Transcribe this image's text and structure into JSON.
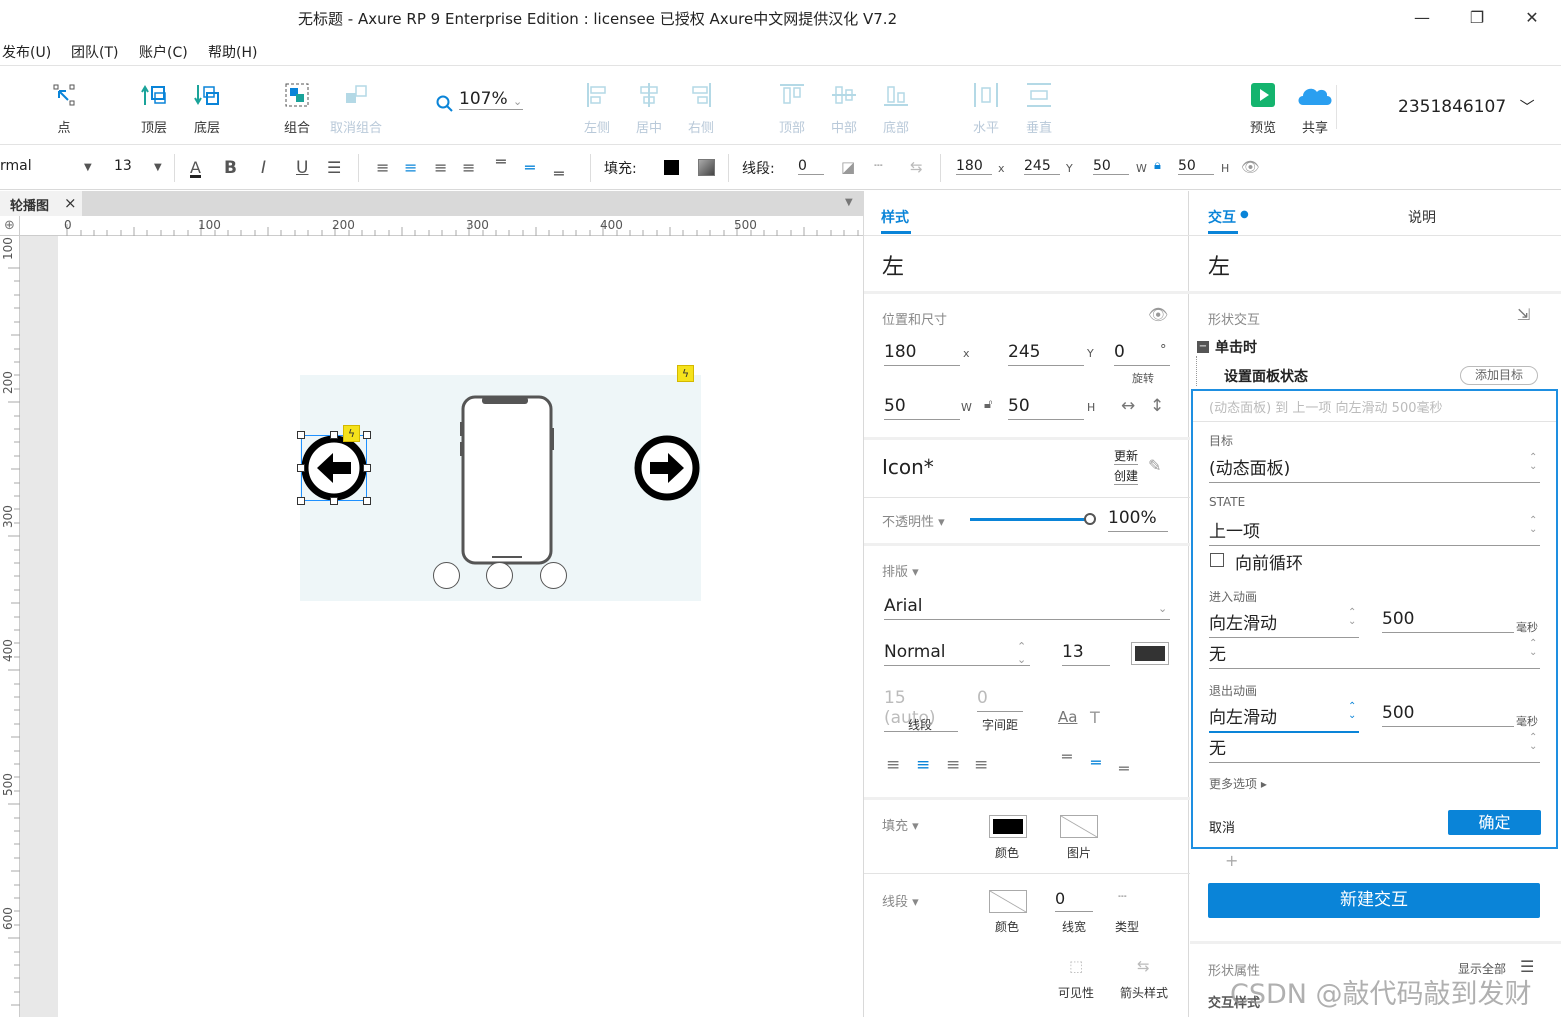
{
  "window": {
    "title": "无标题 - Axure RP 9 Enterprise Edition : licensee 已授权     Axure中文网提供汉化 V7.2",
    "minimize": "—",
    "restore": "❐",
    "close": "✕"
  },
  "menu": {
    "items": [
      "发布(U)",
      "团队(T)",
      "账户(C)",
      "帮助(H)"
    ]
  },
  "toolbar": {
    "point": "点",
    "top_layer": "顶层",
    "bottom_layer": "底层",
    "group": "组合",
    "ungroup": "取消组合",
    "zoom": "107%",
    "align_left": "左侧",
    "align_center": "居中",
    "align_right": "右侧",
    "align_top": "顶部",
    "align_middle": "中部",
    "align_bottom": "底部",
    "distribute_h": "水平",
    "distribute_v": "垂直",
    "preview": "预览",
    "share": "共享",
    "account": "2351846107"
  },
  "format": {
    "style": "rmal",
    "font_size": "13",
    "bold": "B",
    "italic": "I",
    "underline": "U",
    "fill_label": "填充:",
    "stroke_label": "线段:",
    "stroke_value": "0",
    "x": "180",
    "x_unit": "x",
    "y": "245",
    "y_unit": "Y",
    "w": "50",
    "w_unit": "W",
    "h": "50",
    "h_unit": "H"
  },
  "tab": {
    "name": "轮播图",
    "close": "×"
  },
  "ruler": {
    "h_ticks": [
      "0",
      "100",
      "200",
      "300",
      "400",
      "500"
    ],
    "v_ticks": [
      "100",
      "200",
      "300",
      "400",
      "500",
      "600"
    ]
  },
  "style_panel": {
    "tab": "样式",
    "name": "左",
    "pos_size_label": "位置和尺寸",
    "x": "180",
    "x_unit": "x",
    "y": "245",
    "y_unit": "Y",
    "rotate": "0",
    "rotate_unit": "°",
    "rotate_label": "旋转",
    "w": "50",
    "w_unit": "W",
    "h": "50",
    "h_unit": "H",
    "style_name": "Icon*",
    "update": "更新",
    "create": "创建",
    "opacity_label": "不透明性 ▾",
    "opacity": "100%",
    "opacity_fraction": 1.0,
    "typography_label": "排版 ▾",
    "font": "Arial",
    "weight": "Normal",
    "font_size": "13",
    "line_height": "15 (auto)",
    "line_height_label": "线段",
    "letter_spacing": "0",
    "letter_spacing_label": "字间距",
    "fill_label": "填充 ▾",
    "fill_color_label": "颜色",
    "fill_image_label": "图片",
    "stroke_label": "线段 ▾",
    "stroke_color_label": "颜色",
    "stroke_width": "0",
    "stroke_width_label": "线宽",
    "stroke_type_label": "类型",
    "visibility_label": "可见性",
    "arrow_label": "箭头样式",
    "text_color": "#333333"
  },
  "interaction_panel": {
    "tab_interaction": "交互",
    "tab_notes": "说明",
    "name": "左",
    "shape_interactions": "形状交互",
    "event": "单击时",
    "action": "设置面板状态",
    "add_target": "添加目标",
    "summary": "(动态面板) 到 上一项 向左滑动 500毫秒",
    "target_label": "目标",
    "target": "(动态面板)",
    "state_label": "STATE",
    "state": "上一项",
    "loop": "向前循环",
    "enter_anim_label": "进入动画",
    "enter_anim": "向左滑动",
    "enter_ms": "500",
    "enter_ms_unit": "毫秒",
    "enter_easing": "无",
    "exit_anim_label": "退出动画",
    "exit_anim": "向左滑动",
    "exit_ms": "500",
    "exit_ms_unit": "毫秒",
    "exit_easing": "无",
    "more_options": "更多选项 ▸",
    "cancel": "取消",
    "ok": "确定",
    "plus": "+",
    "new_interaction": "新建交互",
    "shape_props": "形状属性",
    "show_all": "显示全部",
    "interaction_style": "交互样式"
  },
  "watermark": "CSDN @敲代码敲到发财",
  "colors": {
    "accent": "#0a84d8",
    "selection": "#1e90ff",
    "panel_bg": "#eef6f8",
    "lightning": "#f5e21b"
  }
}
